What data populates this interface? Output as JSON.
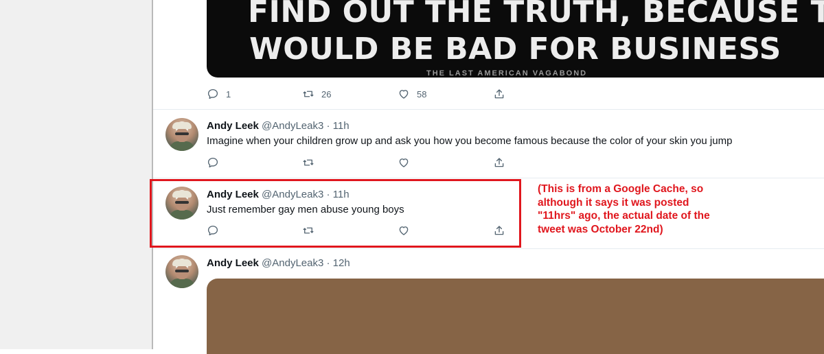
{
  "image_tweet": {
    "media_line1": "FIND OUT THE TRUTH, BECAUSE THAT",
    "media_line2": "WOULD BE BAD FOR BUSINESS",
    "media_credit": "THE LAST AMERICAN VAGABOND",
    "replies": "1",
    "retweets": "26",
    "likes": "58"
  },
  "tweets": [
    {
      "name": "Andy Leek",
      "handle": "@AndyLeak3",
      "time": "11h",
      "text": "Imagine when your children grow up and ask you how you become famous because the color of your skin you jump"
    },
    {
      "name": "Andy Leek",
      "handle": "@AndyLeak3",
      "time": "11h",
      "text": "Just remember gay men abuse young boys"
    },
    {
      "name": "Andy Leek",
      "handle": "@AndyLeak3",
      "time": "12h",
      "text": ""
    }
  ],
  "annotation": {
    "line1": "(This is from a Google Cache, so",
    "line2": "although it says it was posted",
    "line3": "\"11hrs\" ago, the actual date of the",
    "line4": "tweet was October 22nd)"
  },
  "colors": {
    "highlight": "#e0161d",
    "icon_gray": "#536471",
    "brown_media": "#866446"
  },
  "icons": {
    "reply": "reply-icon",
    "retweet": "retweet-icon",
    "like": "like-icon",
    "share": "share-icon"
  }
}
